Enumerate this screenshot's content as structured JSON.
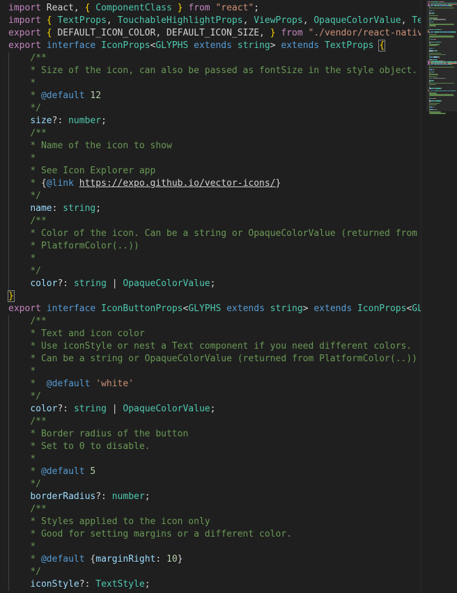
{
  "editor": {
    "lines": [
      [
        [
          "kw",
          "import"
        ],
        [
          "pn",
          " React, "
        ],
        [
          "br",
          "{"
        ],
        [
          "pn",
          " "
        ],
        [
          "ty",
          "ComponentClass"
        ],
        [
          "pn",
          " "
        ],
        [
          "br",
          "}"
        ],
        [
          "pn",
          " "
        ],
        [
          "kw",
          "from"
        ],
        [
          "pn",
          " "
        ],
        [
          "sr",
          "\"react\""
        ],
        [
          "pn",
          ";"
        ]
      ],
      [
        [
          "kw",
          "import"
        ],
        [
          "pn",
          " "
        ],
        [
          "br",
          "{"
        ],
        [
          "pn",
          " "
        ],
        [
          "ty",
          "TextProps"
        ],
        [
          "pn",
          ", "
        ],
        [
          "ty",
          "TouchableHighlightProps"
        ],
        [
          "pn",
          ", "
        ],
        [
          "ty",
          "ViewProps"
        ],
        [
          "pn",
          ", "
        ],
        [
          "ty",
          "OpaqueColorValue"
        ],
        [
          "pn",
          ", "
        ],
        [
          "ty",
          "TextStyle"
        ]
      ],
      [
        [
          "kw",
          "export"
        ],
        [
          "pn",
          " "
        ],
        [
          "br",
          "{"
        ],
        [
          "pn",
          " DEFAULT_ICON_COLOR, DEFAULT_ICON_SIZE, "
        ],
        [
          "br",
          "}"
        ],
        [
          "pn",
          " "
        ],
        [
          "kw",
          "from"
        ],
        [
          "pn",
          " "
        ],
        [
          "sr",
          "\"./vendor/react-native-vecto"
        ]
      ],
      [
        [
          "kw",
          "export"
        ],
        [
          "pn",
          " "
        ],
        [
          "st",
          "interface"
        ],
        [
          "pn",
          " "
        ],
        [
          "ty",
          "IconProps"
        ],
        [
          "pn",
          "<"
        ],
        [
          "ty",
          "GLYPHS"
        ],
        [
          "pn",
          " "
        ],
        [
          "st",
          "extends"
        ],
        [
          "pn",
          " "
        ],
        [
          "ty",
          "string"
        ],
        [
          "pn",
          "> "
        ],
        [
          "st",
          "extends"
        ],
        [
          "pn",
          " "
        ],
        [
          "ty",
          "TextProps"
        ],
        [
          "pn",
          " "
        ],
        [
          "bm",
          "{"
        ]
      ],
      [
        [
          "pn",
          "    "
        ],
        [
          "cm",
          "/**"
        ]
      ],
      [
        [
          "pn",
          "    "
        ],
        [
          "cm",
          "* Size of the icon, can also be passed as fontSize in the style object."
        ]
      ],
      [
        [
          "pn",
          "    "
        ],
        [
          "cm",
          "*"
        ]
      ],
      [
        [
          "pn",
          "    "
        ],
        [
          "cm",
          "* "
        ],
        [
          "tg",
          "@default"
        ],
        [
          "pn",
          " "
        ],
        [
          "nm",
          "12"
        ]
      ],
      [
        [
          "pn",
          "    "
        ],
        [
          "cm",
          "*/"
        ]
      ],
      [
        [
          "pn",
          "    "
        ],
        [
          "vr",
          "size"
        ],
        [
          "pn",
          "?: "
        ],
        [
          "ty",
          "number"
        ],
        [
          "pn",
          ";"
        ]
      ],
      [
        [
          "pn",
          "    "
        ],
        [
          "cm",
          "/**"
        ]
      ],
      [
        [
          "pn",
          "    "
        ],
        [
          "cm",
          "* Name of the icon to show"
        ]
      ],
      [
        [
          "pn",
          "    "
        ],
        [
          "cm",
          "*"
        ]
      ],
      [
        [
          "pn",
          "    "
        ],
        [
          "cm",
          "* See Icon Explorer app"
        ]
      ],
      [
        [
          "pn",
          "    "
        ],
        [
          "cm",
          "* "
        ],
        [
          "pn",
          "{"
        ],
        [
          "tg",
          "@link"
        ],
        [
          "pn",
          " "
        ],
        [
          "lk",
          "https://expo.github.io/vector-icons/"
        ],
        [
          "pn",
          "}"
        ]
      ],
      [
        [
          "pn",
          "    "
        ],
        [
          "cm",
          "*/"
        ]
      ],
      [
        [
          "pn",
          "    "
        ],
        [
          "vr",
          "name"
        ],
        [
          "pn",
          ": "
        ],
        [
          "ty",
          "string"
        ],
        [
          "pn",
          ";"
        ]
      ],
      [
        [
          "pn",
          "    "
        ],
        [
          "cm",
          "/**"
        ]
      ],
      [
        [
          "pn",
          "    "
        ],
        [
          "cm",
          "* Color of the icon. Can be a string or OpaqueColorValue (returned from"
        ]
      ],
      [
        [
          "pn",
          "    "
        ],
        [
          "cm",
          "* PlatformColor(..))"
        ]
      ],
      [
        [
          "pn",
          "    "
        ],
        [
          "cm",
          "*"
        ]
      ],
      [
        [
          "pn",
          "    "
        ],
        [
          "cm",
          "*/"
        ]
      ],
      [
        [
          "pn",
          "    "
        ],
        [
          "vr",
          "color"
        ],
        [
          "pn",
          "?: "
        ],
        [
          "ty",
          "string"
        ],
        [
          "pn",
          " | "
        ],
        [
          "ty",
          "OpaqueColorValue"
        ],
        [
          "pn",
          ";"
        ]
      ],
      [
        [
          "bm",
          "}"
        ]
      ],
      [
        [
          "kw",
          "export"
        ],
        [
          "pn",
          " "
        ],
        [
          "st",
          "interface"
        ],
        [
          "pn",
          " "
        ],
        [
          "ty",
          "IconButtonProps"
        ],
        [
          "pn",
          "<"
        ],
        [
          "ty",
          "GLYPHS"
        ],
        [
          "pn",
          " "
        ],
        [
          "st",
          "extends"
        ],
        [
          "pn",
          " "
        ],
        [
          "ty",
          "string"
        ],
        [
          "pn",
          "> "
        ],
        [
          "st",
          "extends"
        ],
        [
          "pn",
          " "
        ],
        [
          "ty",
          "IconProps"
        ],
        [
          "pn",
          "<"
        ],
        [
          "ty",
          "GLYPHS"
        ],
        [
          "pn",
          ">,"
        ]
      ],
      [
        [
          "pn",
          "    "
        ],
        [
          "cm",
          "/**"
        ]
      ],
      [
        [
          "pn",
          "    "
        ],
        [
          "cm",
          "* Text and icon color"
        ]
      ],
      [
        [
          "pn",
          "    "
        ],
        [
          "cm",
          "* Use iconStyle or nest a Text component if you need different colors."
        ]
      ],
      [
        [
          "pn",
          "    "
        ],
        [
          "cm",
          "* Can be a string or OpaqueColorValue (returned from PlatformColor(..))"
        ]
      ],
      [
        [
          "pn",
          "    "
        ],
        [
          "cm",
          "*"
        ]
      ],
      [
        [
          "pn",
          "    "
        ],
        [
          "cm",
          "*  "
        ],
        [
          "tg",
          "@default"
        ],
        [
          "pn",
          " "
        ],
        [
          "cs",
          "'white'"
        ]
      ],
      [
        [
          "pn",
          "    "
        ],
        [
          "cm",
          "*/"
        ]
      ],
      [
        [
          "pn",
          "    "
        ],
        [
          "vr",
          "color"
        ],
        [
          "pn",
          "?: "
        ],
        [
          "ty",
          "string"
        ],
        [
          "pn",
          " | "
        ],
        [
          "ty",
          "OpaqueColorValue"
        ],
        [
          "pn",
          ";"
        ]
      ],
      [
        [
          "pn",
          "    "
        ],
        [
          "cm",
          "/**"
        ]
      ],
      [
        [
          "pn",
          "    "
        ],
        [
          "cm",
          "* Border radius of the button"
        ]
      ],
      [
        [
          "pn",
          "    "
        ],
        [
          "cm",
          "* Set to 0 to disable."
        ]
      ],
      [
        [
          "pn",
          "    "
        ],
        [
          "cm",
          "*"
        ]
      ],
      [
        [
          "pn",
          "    "
        ],
        [
          "cm",
          "* "
        ],
        [
          "tg",
          "@default"
        ],
        [
          "pn",
          " "
        ],
        [
          "nm",
          "5"
        ]
      ],
      [
        [
          "pn",
          "    "
        ],
        [
          "cm",
          "*/"
        ]
      ],
      [
        [
          "pn",
          "    "
        ],
        [
          "vr",
          "borderRadius"
        ],
        [
          "pn",
          "?: "
        ],
        [
          "ty",
          "number"
        ],
        [
          "pn",
          ";"
        ]
      ],
      [
        [
          "pn",
          "    "
        ],
        [
          "cm",
          "/**"
        ]
      ],
      [
        [
          "pn",
          "    "
        ],
        [
          "cm",
          "* Styles applied to the icon only"
        ]
      ],
      [
        [
          "pn",
          "    "
        ],
        [
          "cm",
          "* Good for setting margins or a different color."
        ]
      ],
      [
        [
          "pn",
          "    "
        ],
        [
          "cm",
          "*"
        ]
      ],
      [
        [
          "pn",
          "    "
        ],
        [
          "cm",
          "* "
        ],
        [
          "tg",
          "@default"
        ],
        [
          "pn",
          " {"
        ],
        [
          "vr",
          "marginRight"
        ],
        [
          "pn",
          ": "
        ],
        [
          "nm",
          "10"
        ],
        [
          "pn",
          "}"
        ]
      ],
      [
        [
          "pn",
          "    "
        ],
        [
          "cm",
          "*/"
        ]
      ],
      [
        [
          "pn",
          "    "
        ],
        [
          "vr",
          "iconStyle"
        ],
        [
          "pn",
          "?: "
        ],
        [
          "ty",
          "TextStyle"
        ],
        [
          "pn",
          ";"
        ]
      ]
    ],
    "guides": [
      4,
      5,
      6,
      7,
      8,
      9,
      10,
      11,
      12,
      13,
      14,
      15,
      16,
      17,
      18,
      19,
      20,
      21,
      22,
      25,
      26,
      27,
      28,
      29,
      30,
      31,
      32,
      33,
      34,
      35,
      36,
      37,
      38,
      39,
      40,
      41,
      42,
      43,
      44,
      45,
      46
    ],
    "colors": {
      "background": "#1f1f1f",
      "keyword": "#c586c0",
      "storage": "#569cd6",
      "type": "#4ec9b0",
      "variable": "#9cdcfe",
      "string": "#ce9178",
      "comment": "#6a9955",
      "number": "#b5cea8",
      "bracket": "#ffd700"
    }
  }
}
